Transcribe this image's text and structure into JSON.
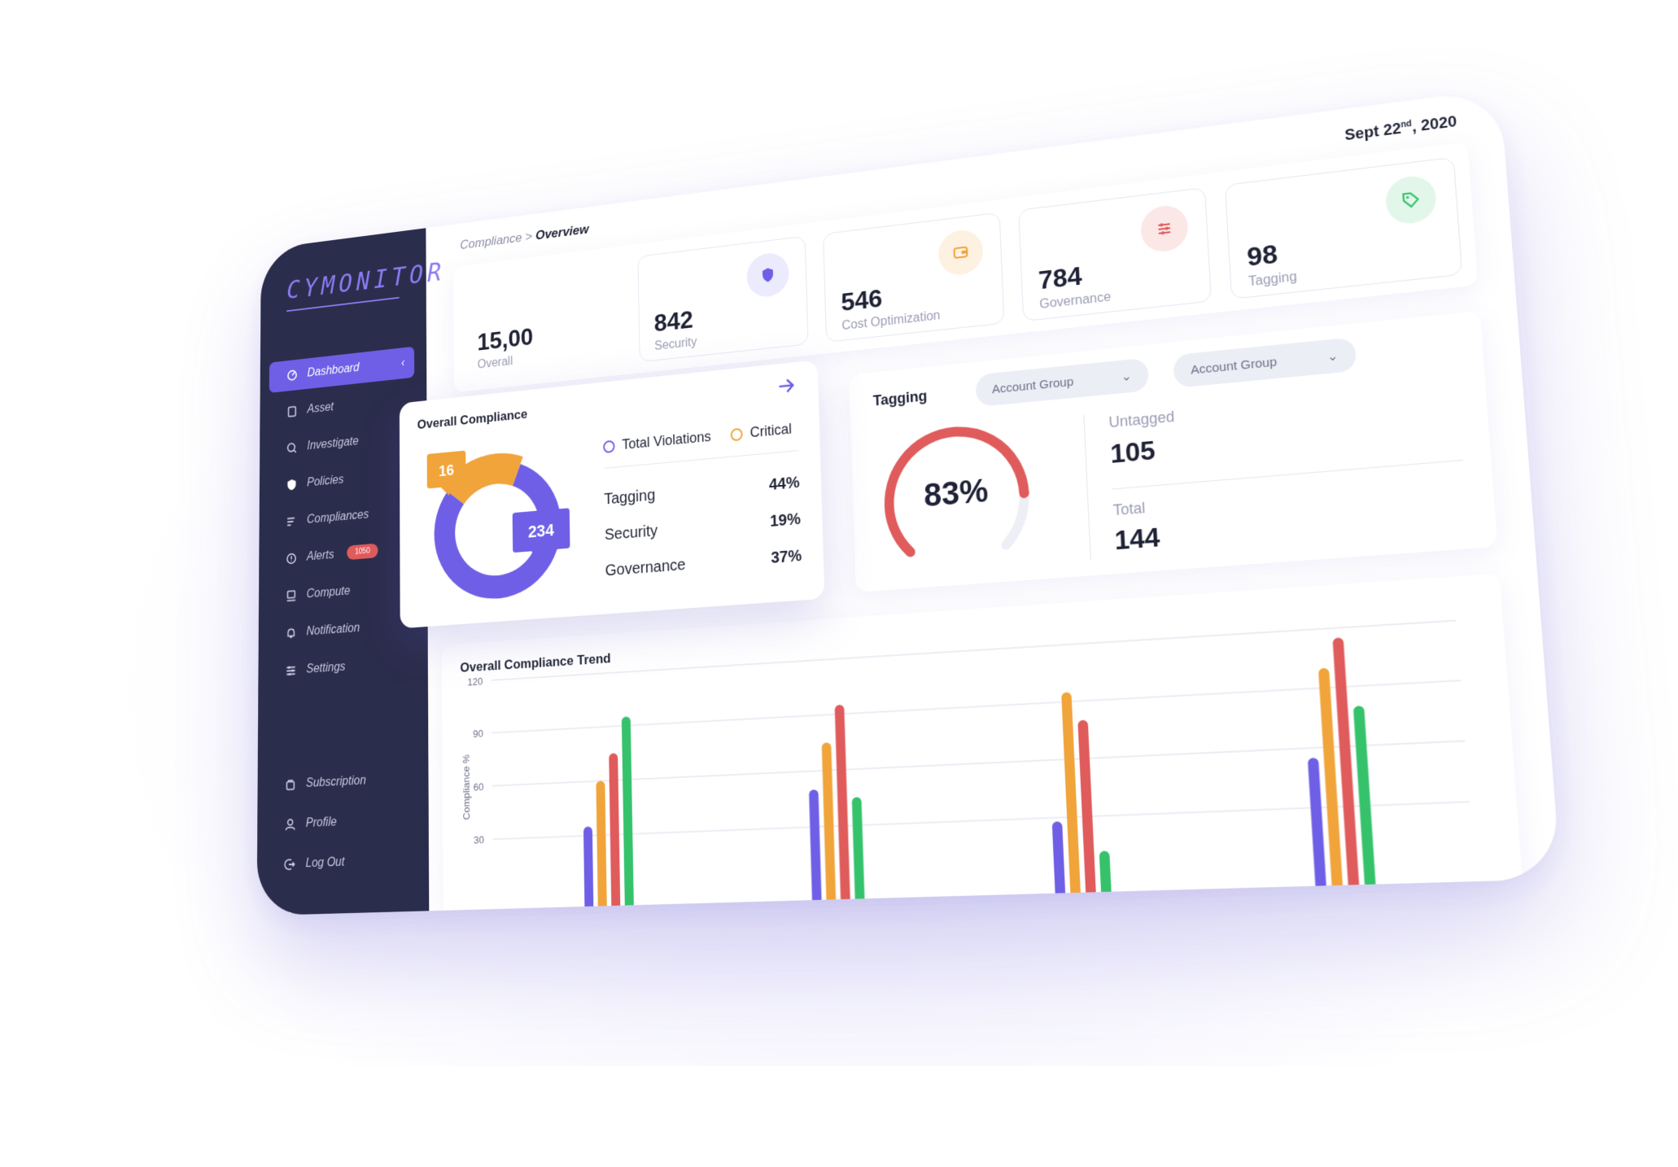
{
  "app": {
    "logo": "CYMONITOR"
  },
  "sidebar": {
    "items": [
      {
        "label": "Dashboard",
        "icon": "dashboard-icon",
        "active": true
      },
      {
        "label": "Asset",
        "icon": "asset-icon"
      },
      {
        "label": "Investigate",
        "icon": "investigate-icon"
      },
      {
        "label": "Policies",
        "icon": "shield-icon"
      },
      {
        "label": "Compliances",
        "icon": "compliance-icon"
      },
      {
        "label": "Alerts",
        "icon": "alert-icon",
        "badge": "1050"
      },
      {
        "label": "Compute",
        "icon": "compute-icon"
      },
      {
        "label": "Notification",
        "icon": "bell-icon"
      },
      {
        "label": "Settings",
        "icon": "settings-icon"
      }
    ],
    "bottom": [
      {
        "label": "Subscription",
        "icon": "subscription-icon"
      },
      {
        "label": "Profile",
        "icon": "user-icon"
      },
      {
        "label": "Log Out",
        "icon": "logout-icon"
      }
    ]
  },
  "header": {
    "breadcrumb_parent": "Compliance",
    "breadcrumb_sep": ">",
    "breadcrumb_current": "Overview",
    "date_main": "Sept 22",
    "date_sup": "nd",
    "date_year": ", 2020"
  },
  "stats": [
    {
      "value": "15,00",
      "label": "Overall",
      "icon": "none"
    },
    {
      "value": "842",
      "label": "Security",
      "icon": "shield-icon",
      "color": "#6e5fe6",
      "bg": "#ecebfd"
    },
    {
      "value": "546",
      "label": "Cost Optimization",
      "icon": "wallet-icon",
      "color": "#f0a43a",
      "bg": "#fdf1e1"
    },
    {
      "value": "784",
      "label": "Governance",
      "icon": "sliders-icon",
      "color": "#e05b5b",
      "bg": "#fce7e7"
    },
    {
      "value": "98",
      "label": "Tagging",
      "icon": "tag-icon",
      "color": "#35c26b",
      "bg": "#e2f7ea"
    }
  ],
  "overall_compliance": {
    "title": "Overall Compliance",
    "legend": [
      {
        "label": "Total Violations",
        "color": "#6e5fe6"
      },
      {
        "label": "Critical",
        "color": "#f0a43a"
      }
    ],
    "rows": [
      {
        "label": "Tagging",
        "pct": "44%"
      },
      {
        "label": "Security",
        "pct": "19%"
      },
      {
        "label": "Governance",
        "pct": "37%"
      }
    ],
    "donut": {
      "critical": 16,
      "total_violations": 234
    }
  },
  "tagging": {
    "title": "Tagging",
    "dropdown1": "Account Group",
    "dropdown2": "Account Group",
    "gauge_value": "83%",
    "gauge_fraction": 0.83,
    "untagged_label": "Untagged",
    "untagged_value": "105",
    "total_label": "Total",
    "total_value": "144"
  },
  "trend": {
    "title": "Overall Compliance Trend"
  },
  "chart_data": {
    "type": "bar",
    "title": "Overall Compliance Trend",
    "ylabel": "Compliance %",
    "ylim": [
      0,
      120
    ],
    "yticks": [
      "120",
      "90",
      "60",
      "30"
    ],
    "categories": [
      "",
      "",
      "",
      ""
    ],
    "series": [
      {
        "color": "#6e5fe6",
        "values": [
          35,
          50,
          28,
          55
        ]
      },
      {
        "color": "#f0a43a",
        "values": [
          60,
          75,
          95,
          100
        ]
      },
      {
        "color": "#e05b5b",
        "values": [
          75,
          95,
          80,
          115
        ]
      },
      {
        "color": "#35c26b",
        "values": [
          95,
          45,
          12,
          80
        ]
      }
    ]
  }
}
